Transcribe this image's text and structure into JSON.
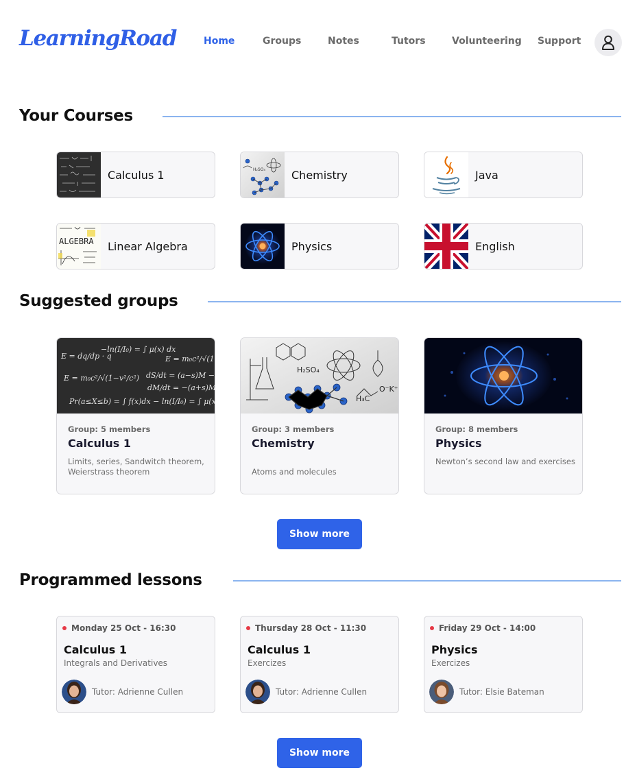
{
  "header": {
    "logo": "LearningRoad",
    "nav": [
      {
        "label": "Home",
        "active": true
      },
      {
        "label": "Groups",
        "active": false
      },
      {
        "label": "Notes",
        "active": false
      },
      {
        "label": "Tutors",
        "active": false
      },
      {
        "label": "Volunteering",
        "active": false
      },
      {
        "label": "Support",
        "active": false
      }
    ],
    "profile_icon": "user-icon"
  },
  "colors": {
    "accent": "#2f63e8",
    "section_line": "#8bb4ef",
    "card_bg": "#f7f7f9",
    "lesson_dot": "#e63946"
  },
  "courses": {
    "title": "Your Courses",
    "items": [
      {
        "name": "Calculus 1",
        "thumbnail": "calculus-blackboard-image"
      },
      {
        "name": "Chemistry",
        "thumbnail": "chemistry-sketch-image"
      },
      {
        "name": "Java",
        "thumbnail": "java-logo-image"
      },
      {
        "name": "Linear Algebra",
        "thumbnail": "algebra-sketch-image"
      },
      {
        "name": "Physics",
        "thumbnail": "atom-image"
      },
      {
        "name": "English",
        "thumbnail": "union-jack-flag-image"
      }
    ]
  },
  "groups": {
    "title": "Suggested groups",
    "items": [
      {
        "meta": "Group: 5 members",
        "name": "Calculus 1",
        "description": "Limits, series, Sandwitch theorem, Weierstrass theorem"
      },
      {
        "meta": "Group: 3 members",
        "name": "Chemistry",
        "description": "Atoms and molecules"
      },
      {
        "meta": "Group: 8 members",
        "name": "Physics",
        "description": "Newton’s second law and exercises"
      }
    ],
    "show_more": "Show more"
  },
  "lessons": {
    "title": "Programmed lessons",
    "items": [
      {
        "date": "Monday 25 Oct - 16:30",
        "course": "Calculus 1",
        "topic": "Integrals and Derivatives",
        "tutor": "Tutor: Adrienne Cullen"
      },
      {
        "date": "Thursday 28 Oct - 11:30",
        "course": "Calculus 1",
        "topic": "Exercizes",
        "tutor": "Tutor: Adrienne Cullen"
      },
      {
        "date": "Friday 29 Oct - 14:00",
        "course": "Physics",
        "topic": "Exercizes",
        "tutor": "Tutor: Elsie Bateman"
      }
    ],
    "show_more": "Show more"
  }
}
